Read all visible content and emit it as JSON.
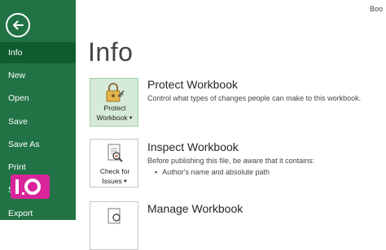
{
  "window": {
    "title_fragment": "Boo"
  },
  "sidebar": {
    "items": [
      {
        "label": "Info",
        "active": true
      },
      {
        "label": "New"
      },
      {
        "label": "Open"
      },
      {
        "label": "Save"
      },
      {
        "label": "Save As"
      },
      {
        "label": "Print"
      },
      {
        "label": "Share"
      },
      {
        "label": "Export"
      }
    ]
  },
  "watermark": {
    "text": "IO",
    "color": "#d9249a"
  },
  "colors": {
    "sidebar_bg": "#217346",
    "sidebar_active": "#0e5c30",
    "tile_selected": "#d5ead9"
  },
  "page": {
    "title": "Info"
  },
  "sections": {
    "protect": {
      "tile_line1": "Protect",
      "tile_line2": "Workbook",
      "title": "Protect Workbook",
      "description": "Control what types of changes people can make to this workbook."
    },
    "inspect": {
      "tile_line1": "Check for",
      "tile_line2": "Issues",
      "title": "Inspect Workbook",
      "description": "Before publishing this file, be aware that it contains:",
      "bullets": [
        "Author's name and absolute path"
      ]
    },
    "manage": {
      "title": "Manage Workbook"
    }
  }
}
